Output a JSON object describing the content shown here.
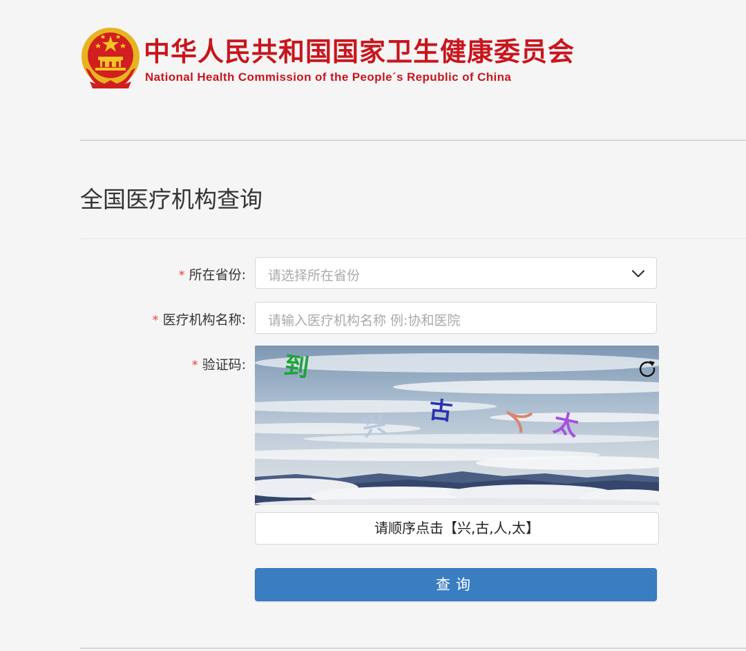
{
  "header": {
    "org_name_cn": "中华人民共和国国家卫生健康委员会",
    "org_name_en": "National Health Commission of the People´s Republic of China"
  },
  "page": {
    "title": "全国医疗机构查询"
  },
  "form": {
    "required_mark": "*",
    "province": {
      "label": "所在省份:",
      "placeholder": "请选择所在省份"
    },
    "institution": {
      "label": "医疗机构名称:",
      "placeholder": "请输入医疗机构名称  例:协和医院"
    },
    "captcha": {
      "label": "验证码:",
      "chars": [
        "到",
        "兴",
        "古",
        "人",
        "太"
      ],
      "char_colors": [
        "#1fa33a",
        "#b9c8dc",
        "#2a32b0",
        "#d9846f",
        "#a64fe0"
      ],
      "instruction": "请顺序点击【兴,古,人,太】"
    },
    "submit_label": "查询"
  },
  "colors": {
    "brand_red": "#c8161d",
    "primary_button": "#3a7dc1",
    "required": "#e8483e"
  }
}
